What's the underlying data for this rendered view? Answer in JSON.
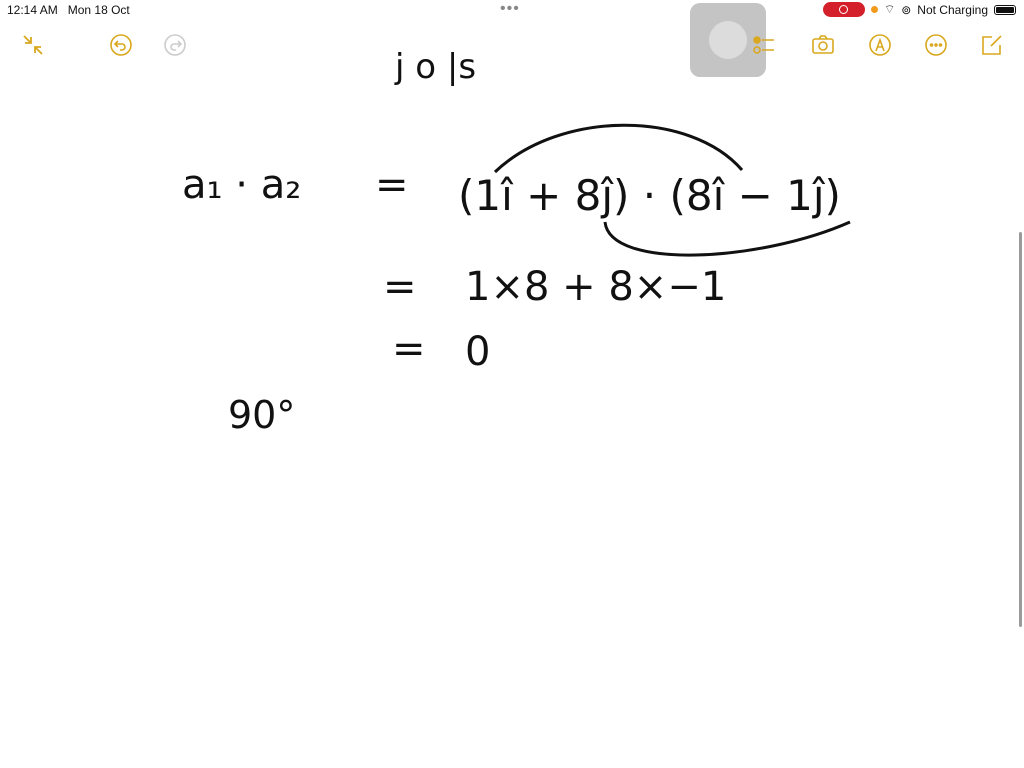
{
  "status_bar": {
    "time": "12:14 AM",
    "date": "Mon 18 Oct",
    "charging": "Not Charging",
    "battery_level": 0.9
  },
  "colors": {
    "accent": "#d9a81e",
    "record": "#d4202a"
  },
  "toolbar": {
    "left": [
      "collapse-icon",
      "undo-icon",
      "redo-icon"
    ],
    "right": [
      "checklist-icon",
      "camera-icon",
      "markup-pen-icon",
      "more-icon",
      "compose-icon"
    ]
  },
  "note": {
    "top_partial": "j  o   |s",
    "line1_lhs": "a₁ · a₂",
    "line1_eq": "=",
    "line1_rhs": "(1î + 8ĵ) · (8î − 1ĵ)",
    "line2_eq": "=",
    "line2_rhs": "1×8 + 8×−1",
    "line3_eq": "=",
    "line3_rhs": "0",
    "angle": "90°"
  }
}
